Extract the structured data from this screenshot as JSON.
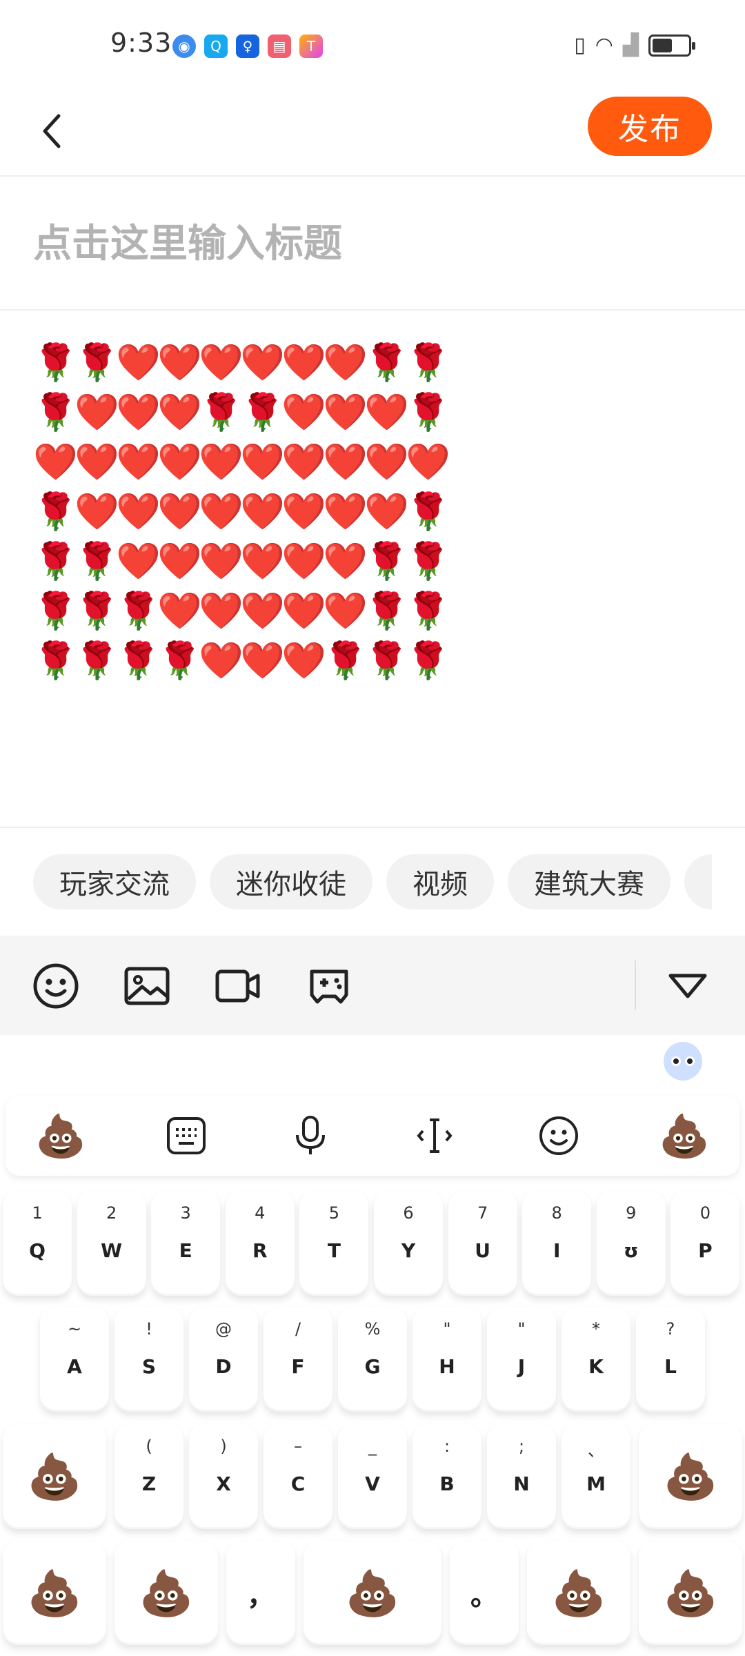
{
  "status_bar": {
    "time": "9:33",
    "app_icons": [
      "browser-icon",
      "search-app-icon",
      "bulb-app-icon",
      "book-app-icon",
      "paint-app-icon"
    ],
    "battery_level_percent": 55
  },
  "header": {
    "publish_label": "发布"
  },
  "title_input": {
    "placeholder": "点击这里输入标题"
  },
  "content": {
    "emoji_rows": [
      [
        "🌹",
        "🌹",
        "❤️",
        "❤️",
        "❤️",
        "❤️",
        "❤️",
        "❤️",
        "🌹",
        "🌹"
      ],
      [
        "🌹",
        "❤️",
        "❤️",
        "❤️",
        "🌹",
        "🌹",
        "❤️",
        "❤️",
        "❤️",
        "🌹"
      ],
      [
        "❤️",
        "❤️",
        "❤️",
        "❤️",
        "❤️",
        "❤️",
        "❤️",
        "❤️",
        "❤️",
        "❤️"
      ],
      [
        "🌹",
        "❤️",
        "❤️",
        "❤️",
        "❤️",
        "❤️",
        "❤️",
        "❤️",
        "❤️",
        "🌹"
      ],
      [
        "🌹",
        "🌹",
        "❤️",
        "❤️",
        "❤️",
        "❤️",
        "❤️",
        "❤️",
        "🌹",
        "🌹"
      ],
      [
        "🌹",
        "🌹",
        "🌹",
        "❤️",
        "❤️",
        "❤️",
        "❤️",
        "❤️",
        "🌹",
        "🌹"
      ],
      [
        "🌹",
        "🌹",
        "🌹",
        "🌹",
        "❤️",
        "❤️",
        "❤️",
        "🌹",
        "🌹",
        "🌹"
      ]
    ]
  },
  "topics": [
    "玩家交流",
    "迷你收徒",
    "视频",
    "建筑大赛"
  ],
  "toolbar": {
    "tools": [
      "emoji-icon",
      "image-icon",
      "video-icon",
      "gamepad-icon"
    ],
    "collapse_icon": "triangle-down-icon"
  },
  "keyboard": {
    "suggestion_bar": [
      "💩",
      "keyboard-icon",
      "microphone-icon",
      "cursor-icon",
      "smiley-icon",
      "💩"
    ],
    "row1": [
      {
        "hint": "1",
        "key": "Q"
      },
      {
        "hint": "2",
        "key": "W"
      },
      {
        "hint": "3",
        "key": "E"
      },
      {
        "hint": "4",
        "key": "R"
      },
      {
        "hint": "5",
        "key": "T"
      },
      {
        "hint": "6",
        "key": "Y"
      },
      {
        "hint": "7",
        "key": "U"
      },
      {
        "hint": "8",
        "key": "I"
      },
      {
        "hint": "9",
        "key": "ʊ"
      },
      {
        "hint": "0",
        "key": "P"
      }
    ],
    "row2": [
      {
        "hint": "~",
        "key": "A"
      },
      {
        "hint": "!",
        "key": "S"
      },
      {
        "hint": "@",
        "key": "D"
      },
      {
        "hint": "/",
        "key": "F"
      },
      {
        "hint": "%",
        "key": "G"
      },
      {
        "hint": "\"",
        "key": "H"
      },
      {
        "hint": "\"",
        "key": "J"
      },
      {
        "hint": "*",
        "key": "K"
      },
      {
        "hint": "?",
        "key": "L"
      }
    ],
    "row3": [
      {
        "hint": "(",
        "key": "Z"
      },
      {
        "hint": ")",
        "key": "X"
      },
      {
        "hint": "–",
        "key": "C"
      },
      {
        "hint": "_",
        "key": "V"
      },
      {
        "hint": ":",
        "key": "B"
      },
      {
        "hint": ";",
        "key": "N"
      },
      {
        "hint": "、",
        "key": "M"
      }
    ],
    "row3_side_emoji": "💩",
    "row4": [
      "💩",
      "💩",
      "，",
      "💩",
      "。",
      "💩",
      "💩"
    ]
  }
}
